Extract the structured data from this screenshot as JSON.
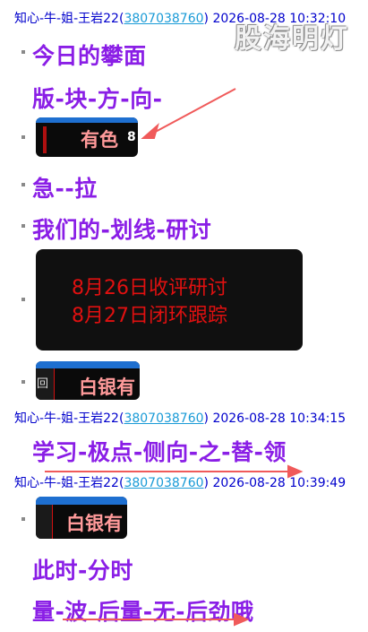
{
  "watermark": "股海明灯",
  "messages": [
    {
      "sender": "知心-牛-姐-王岩22(",
      "qq": "3807038760",
      "close": ")",
      "time": "2026-08-28 10:32:10"
    },
    {
      "sender": "知心-牛-姐-王岩22(",
      "qq": "3807038760",
      "close": ")",
      "time": "2026-08-28 10:34:15"
    },
    {
      "sender": "知心-牛-姐-王岩22(",
      "qq": "3807038760",
      "close": ")",
      "time": "2026-08-28 10:39:49"
    }
  ],
  "lines": {
    "l1": "今日的攀面",
    "l2": "版-块-方-向-",
    "l3": "急--拉",
    "l4": "我们的-划线-研讨",
    "l5": "学习-极点-侧向-之-替-领",
    "l6": "此时-分时",
    "l7": "量-波-后量-无-后劲哦"
  },
  "images": {
    "img1_text": "有色",
    "img1_suffix": "8",
    "img2_line1": "8月26日收评研讨",
    "img2_line2": "8月27日闭环跟踪",
    "img3_prefix": "回",
    "img3_text": "白银有",
    "img4_text": "白银有"
  },
  "colors": {
    "purple": "#8a1ee6",
    "blue": "#0000cc",
    "link": "#1a9bd7",
    "arrow": "#f05a5a",
    "red_text": "#e01010"
  }
}
